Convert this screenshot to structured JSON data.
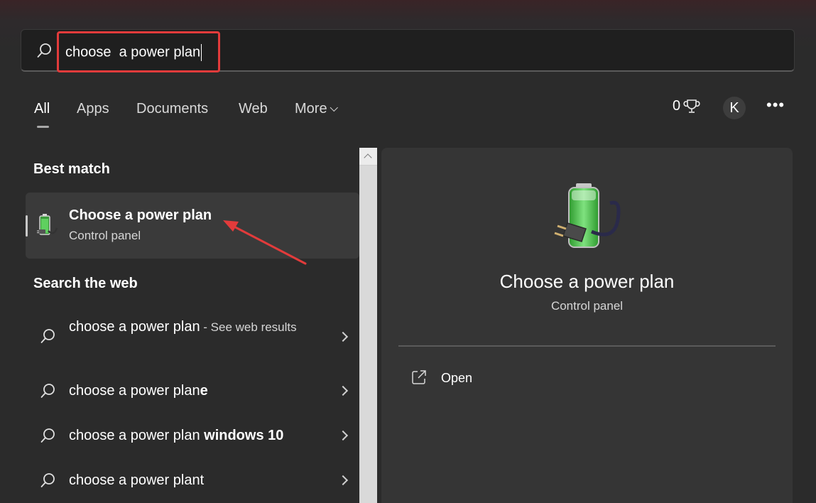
{
  "search": {
    "value": "choose  a power plan",
    "icon": "search-icon"
  },
  "tabs": [
    {
      "label": "All",
      "active": true
    },
    {
      "label": "Apps"
    },
    {
      "label": "Documents"
    },
    {
      "label": "Web"
    },
    {
      "label": "More"
    }
  ],
  "header": {
    "points": "0",
    "points_icon": "trophy-icon",
    "avatar_initial": "K",
    "more_icon": "more-options-icon"
  },
  "best_match": {
    "section_title": "Best match",
    "title": "Choose a power plan",
    "subtitle": "Control panel",
    "icon": "battery-power-icon"
  },
  "web": {
    "section_title": "Search the web",
    "items": [
      {
        "prefix": "choose a power plan",
        "bold": "",
        "suffix": " - See web results"
      },
      {
        "prefix": "choose a power plan",
        "bold": "e",
        "suffix": ""
      },
      {
        "prefix": "choose a power plan",
        "bold": " windows 10",
        "suffix": ""
      },
      {
        "prefix": "choose a power plan",
        "bold": "t",
        "suffix": ""
      }
    ]
  },
  "detail": {
    "title": "Choose a power plan",
    "subtitle": "Control panel",
    "open_label": "Open",
    "open_icon": "open-external-icon"
  },
  "colors": {
    "highlight_box": "#e23b3b",
    "annotation_arrow": "#e23b3b",
    "background": "#2b2b2b",
    "pane": "#353535"
  }
}
